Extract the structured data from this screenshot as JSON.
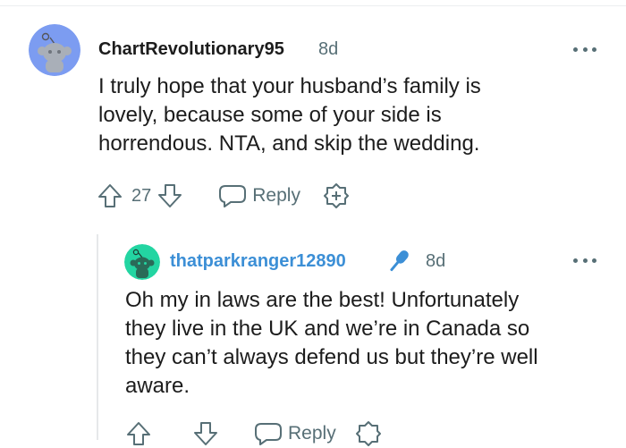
{
  "comment1": {
    "username": "ChartRevolutionary95",
    "timestamp": "8d",
    "avatar_icon": "reddit-snoo-avatar-icon",
    "avatar_color": "#7c9cf1",
    "body_lines": [
      "I truly hope that your husband’s family is",
      "lovely, because some of your side is",
      "horrendous. NTA, and skip the wedding."
    ],
    "vote_count": "27",
    "reply_label": "Reply"
  },
  "comment2": {
    "username": "thatparkranger12890",
    "username_color": "#3c8fd6",
    "badge_icon": "microphone-icon",
    "timestamp": "8d",
    "avatar_icon": "reddit-snoo-avatar-icon",
    "avatar_color": "#23d5a2",
    "body_lines": [
      "Oh my in laws are the best! Unfortunately",
      "they live in the UK and we’re in Canada so",
      "they can’t always defend us but they’re well",
      "aware."
    ],
    "reply_label": "Reply"
  }
}
